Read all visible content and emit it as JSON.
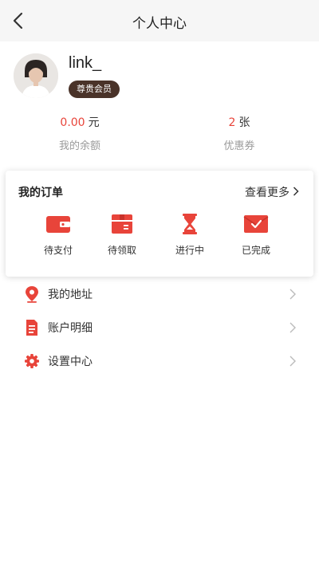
{
  "header": {
    "title": "个人中心"
  },
  "profile": {
    "username": "link_",
    "member_badge": "尊贵会员",
    "balance": {
      "value": "0.00",
      "unit": "元",
      "label": "我的余额"
    },
    "coupons": {
      "value": "2",
      "unit": "张",
      "label": "优惠券"
    }
  },
  "orders": {
    "title": "我的订单",
    "more_label": "查看更多",
    "items": [
      {
        "label": "待支付",
        "icon": "wallet-icon"
      },
      {
        "label": "待领取",
        "icon": "package-icon"
      },
      {
        "label": "进行中",
        "icon": "hourglass-icon"
      },
      {
        "label": "已完成",
        "icon": "envelope-check-icon"
      }
    ]
  },
  "menu": [
    {
      "label": "我的地址",
      "icon": "location-pin-icon"
    },
    {
      "label": "账户明细",
      "icon": "document-icon"
    },
    {
      "label": "设置中心",
      "icon": "gear-icon"
    }
  ],
  "colors": {
    "accent": "#e8443a",
    "badge_bg": "#4a3329",
    "muted_text": "#9a9a9a",
    "header_bg": "#f6f6f6"
  }
}
